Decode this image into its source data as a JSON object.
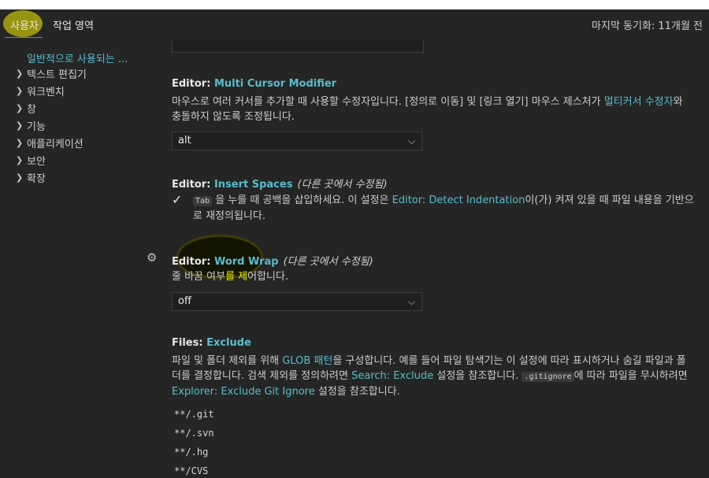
{
  "tabs": {
    "user": "사용자",
    "workspace": "작업 영역"
  },
  "sync_status": "마지막 동기화: 11개월 전",
  "tree": {
    "selected": "일반적으로 사용되는 ...",
    "items": [
      "텍스트 편집기",
      "워크벤치",
      "창",
      "기능",
      "애플리케이션",
      "보안",
      "확장"
    ]
  },
  "multi_cursor": {
    "prefix": "Editor: ",
    "name": "Multi Cursor Modifier",
    "desc_a": "마우스로 여러 커서를 추가할 때 사용할 수정자입니다. [정의로 이동] 및 [링크 열기] 마우스 제스처가 ",
    "desc_link": "멀티커서 수정자",
    "desc_b": "와 충돌하지 않도록 조정됩니다.",
    "value": "alt"
  },
  "insert_spaces": {
    "prefix": "Editor: ",
    "name": "Insert Spaces",
    "modified": "(다른 곳에서 수정됨)",
    "key": "Tab",
    "desc_a": "을 누를 때 공백을 삽입하세요. 이 설정은 ",
    "desc_link": "Editor: Detect Indentation",
    "desc_b": "이(가) 켜져 있을 때 파일 내용을 기반으로 재정의됩니다.",
    "checked": true
  },
  "word_wrap": {
    "prefix": "Editor: ",
    "name": "Word Wrap",
    "modified": "(다른 곳에서 수정됨)",
    "desc_a": "줄 바꿈 여부",
    "desc_b": "를 제",
    "desc_c": "어합니다.",
    "value": "off"
  },
  "files_exclude": {
    "prefix": "Files: ",
    "name": "Exclude",
    "desc_a": "파일 및 폴더 제외를 위해 ",
    "desc_link1": "GLOB 패턴",
    "desc_b": "을 구성합니다. 예를 들어 파일 탐색기는 이 설정에 따라 표시하거나 숨길 파일과 폴더를 결정합니다. 검색 제외를 정의하려면 ",
    "desc_link2": "Search: Exclude",
    "desc_c": " 설정을 참조합니다. ",
    "desc_code": ".gitignore",
    "desc_d": "에 따라 파일을 무시하려면 ",
    "desc_link3": "Explorer: Exclude Git Ignore",
    "desc_e": " 설정을 참조합니다.",
    "patterns": [
      "**/.git",
      "**/.svn",
      "**/.hg",
      "**/CVS"
    ]
  },
  "icons": {
    "chevron": "chevron-right-icon",
    "gear": "gear-icon",
    "check": "check-icon",
    "caret": "chevron-down-icon"
  }
}
